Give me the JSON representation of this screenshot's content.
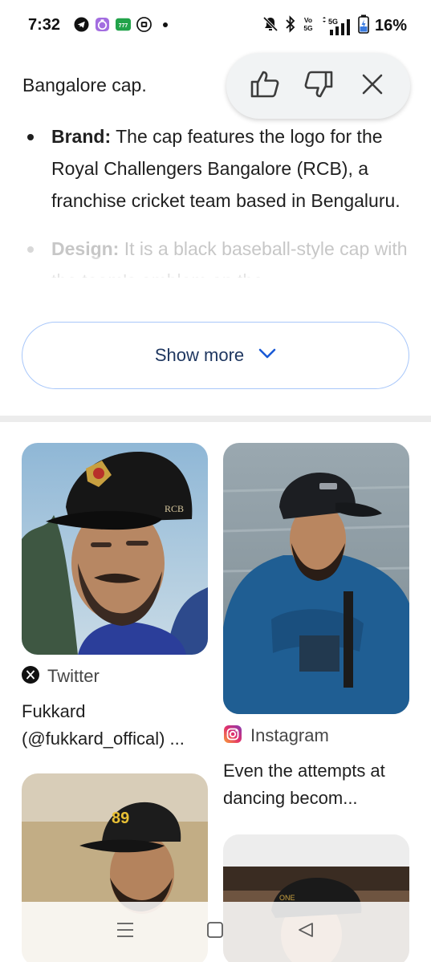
{
  "status_bar": {
    "time": "7:32",
    "battery_percent": "16%",
    "network": "5G"
  },
  "overview": {
    "lead_text": "Bangalore cap.",
    "bullets": [
      {
        "label": "Brand:",
        "text": " The cap features the logo for the Royal Challengers Bangalore (RCB), a franchise cricket team based in Bengaluru."
      },
      {
        "label": "Design:",
        "text": " It is a black baseball-style cap with the team's emblem on the"
      }
    ]
  },
  "feedback": {
    "thumbs_up_icon": "thumbs-up-icon",
    "thumbs_down_icon": "thumbs-down-icon",
    "close_icon": "close-icon"
  },
  "show_more": {
    "label": "Show more"
  },
  "results": [
    {
      "source": "Twitter",
      "caption": "Fukkard (@fukkard_offical) ...",
      "image_text": "RCB"
    },
    {
      "source": "Instagram",
      "caption": "Even the attempts at dancing becom..."
    },
    {
      "image_text": "89"
    },
    {
      "image_text": "ONE"
    }
  ],
  "colors": {
    "accent_border": "#a8c7fa",
    "show_more_text": "#1f3760",
    "faded_text": "#c7c7c7"
  }
}
